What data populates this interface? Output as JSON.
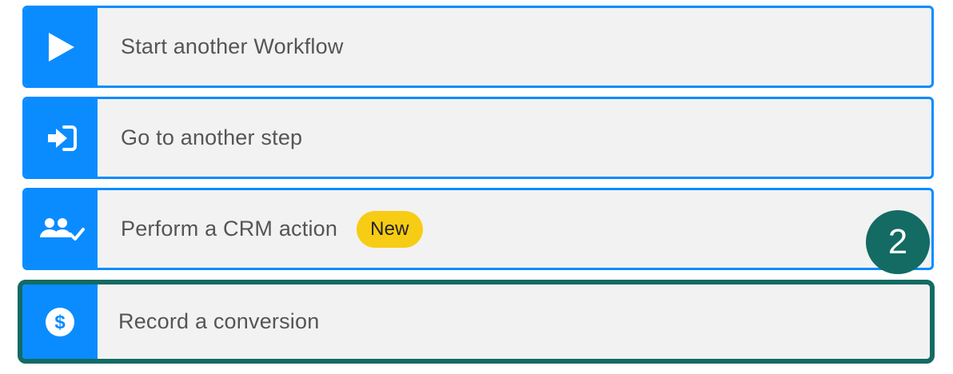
{
  "actions": [
    {
      "label": "Start another Workflow",
      "icon": "play-icon"
    },
    {
      "label": "Go to another step",
      "icon": "sign-in-arrow-icon"
    },
    {
      "label": "Perform a CRM action",
      "icon": "users-check-icon",
      "badge": "New"
    },
    {
      "label": "Record a conversion",
      "icon": "dollar-circle-icon"
    }
  ],
  "step_marker": "2",
  "colors": {
    "accent_blue": "#0a8cff",
    "selected_border": "#136b63",
    "badge_yellow": "#f7cc14",
    "item_background": "#f2f2f2"
  }
}
